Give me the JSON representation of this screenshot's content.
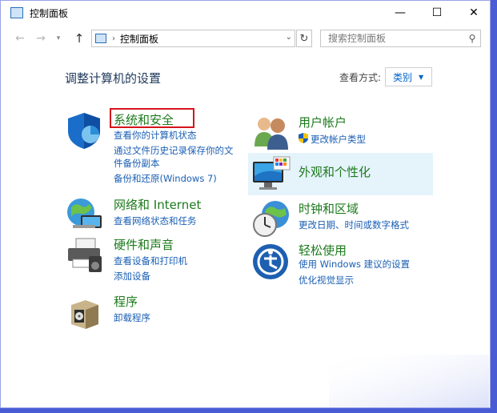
{
  "window": {
    "title": "控制面板",
    "minimize": "—",
    "maximize": "☐",
    "close": "✕"
  },
  "nav": {
    "back": "←",
    "forward": "→",
    "recent": "▾",
    "up": "↑",
    "refresh": "↻"
  },
  "address": {
    "path": "控制面板"
  },
  "search": {
    "placeholder": "搜索控制面板"
  },
  "heading": "调整计算机的设置",
  "view_by": {
    "label": "查看方式:",
    "value": "类别"
  },
  "categories": [
    {
      "title": "系统和安全",
      "links": [
        "查看你的计算机状态",
        "通过文件历史记录保存你的文件备份副本",
        "备份和还原(Windows 7)"
      ]
    },
    {
      "title": "网络和 Internet",
      "links": [
        "查看网络状态和任务"
      ]
    },
    {
      "title": "硬件和声音",
      "links": [
        "查看设备和打印机",
        "添加设备"
      ]
    },
    {
      "title": "程序",
      "links": [
        "卸载程序"
      ]
    },
    {
      "title": "用户帐户",
      "links": [
        "更改帐户类型"
      ]
    },
    {
      "title": "外观和个性化",
      "links": []
    },
    {
      "title": "时钟和区域",
      "links": [
        "更改日期、时间或数字格式"
      ]
    },
    {
      "title": "轻松使用",
      "links": [
        "使用 Windows 建议的设置",
        "优化视觉显示"
      ]
    }
  ],
  "colors": {
    "category_title": "#1c7a1c",
    "link": "#1a5fb4",
    "highlight_box": "#d4151b",
    "hover_bg": "#e5f3fb"
  },
  "icons": [
    "shield-icon",
    "globe-network-icon",
    "printer-icon",
    "programs-box-icon",
    "users-icon",
    "display-palette-icon",
    "clock-globe-icon",
    "ease-of-access-icon"
  ]
}
